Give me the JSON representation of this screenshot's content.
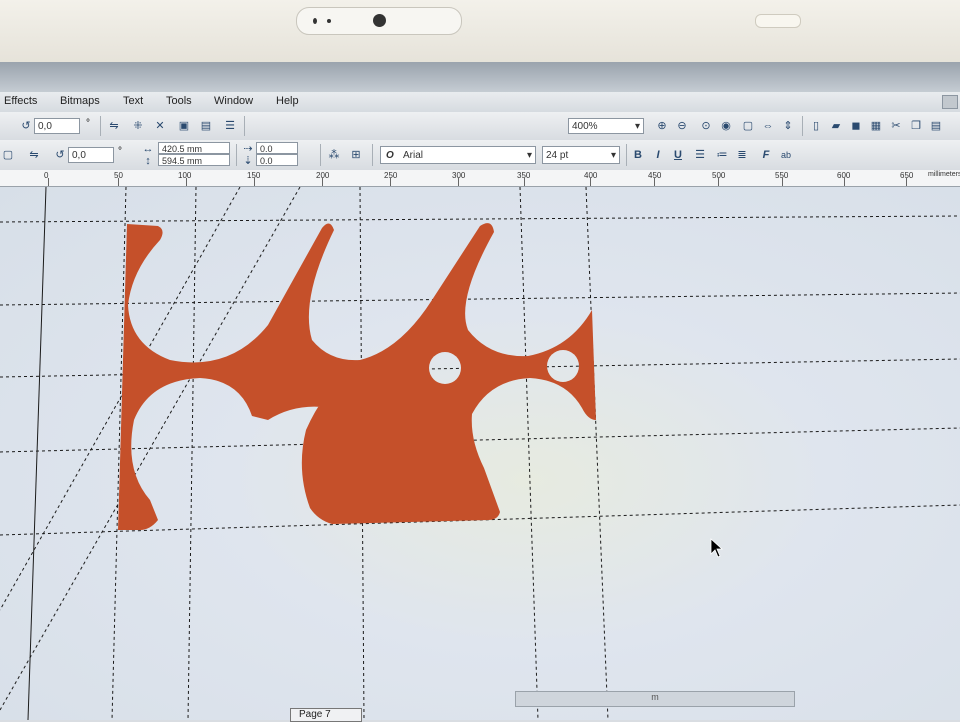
{
  "menubar": {
    "items": [
      {
        "label": "Effects"
      },
      {
        "label": "Bitmaps"
      },
      {
        "label": "Text"
      },
      {
        "label": "Tools"
      },
      {
        "label": "Window"
      },
      {
        "label": "Help"
      }
    ]
  },
  "toolbar1": {
    "rotation_value": "0,0",
    "degree_symbol": "°",
    "zoom_value": "400%"
  },
  "toolbar2": {
    "rotation_value": "0,0",
    "degree_symbol": "°",
    "width_value": "420.5 mm",
    "height_value": "594.5 mm",
    "offset_x": "0.0",
    "offset_y": "0.0",
    "font_name": "Arial",
    "font_size": "24 pt"
  },
  "ruler": {
    "labels": [
      "0",
      "50",
      "100",
      "150",
      "200",
      "250",
      "300",
      "350",
      "400",
      "450",
      "500",
      "550",
      "600",
      "650",
      "millimeters"
    ]
  },
  "status": {
    "page_tab": "Page 7",
    "scroll_label": "m"
  },
  "colors": {
    "shape_fill": "#c5502a",
    "canvas_bg": "#dde3ea",
    "guide": "#1b1b1b"
  }
}
